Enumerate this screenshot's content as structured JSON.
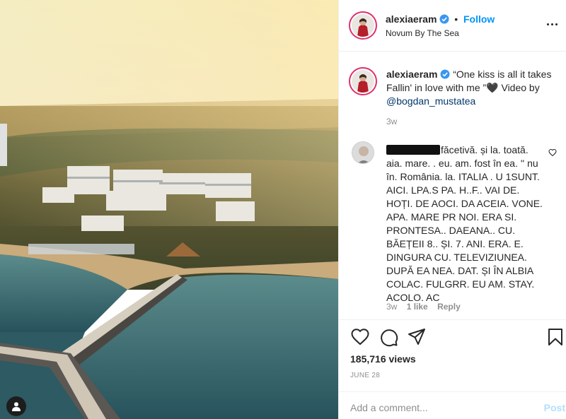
{
  "header": {
    "username": "alexiaeram",
    "separator": "•",
    "follow_label": "Follow",
    "location": "Novum By The Sea"
  },
  "caption": {
    "username": "alexiaeram",
    "text": "“One kiss is all it takes Fallin' in love with me ”🖤 Video by ",
    "mention": "@bogdan_mustatea",
    "time": "3w"
  },
  "comment": {
    "text": "făcetivă. și la. toată. aia. mare. . eu. am. fost în ea. '' nu în. România. la. ITALIA . U 1SUNT. AICI. LPA.S PA. H..F.. VAI DE. HOȚI. DE AOCI. DA ACEIA. VONE. APA. MARE PR NOI. ERA SI. PRONTESA.. DAEANA.. CU. BĂEȚEII 8.. ȘI. 7. ANI. ERA. E. DINGURA CU. TELEVIZIUNEA. DUPĂ EA NEA. DAT. ȘI ÎN ALBIA COLAC. FULGRR. EU AM. STAY. ACOLO. AC",
    "time": "3w",
    "likes": "1 like",
    "reply_label": "Reply"
  },
  "stats": {
    "views": "185,716 views",
    "date": "JUNE 28"
  },
  "composer": {
    "placeholder": "Add a comment...",
    "post_label": "Post"
  },
  "icons": {
    "verified": "verified-badge-icon",
    "like": "heart-icon",
    "comment": "comment-bubble-icon",
    "share": "paper-plane-icon",
    "save": "bookmark-icon",
    "more": "more-options-icon",
    "tag": "user-tag-icon"
  },
  "colors": {
    "link_blue": "#0095f6",
    "mention": "#00376b",
    "muted": "#8e8e8e",
    "story_ring": "#e1306c",
    "post_disabled": "#b2dffc"
  }
}
